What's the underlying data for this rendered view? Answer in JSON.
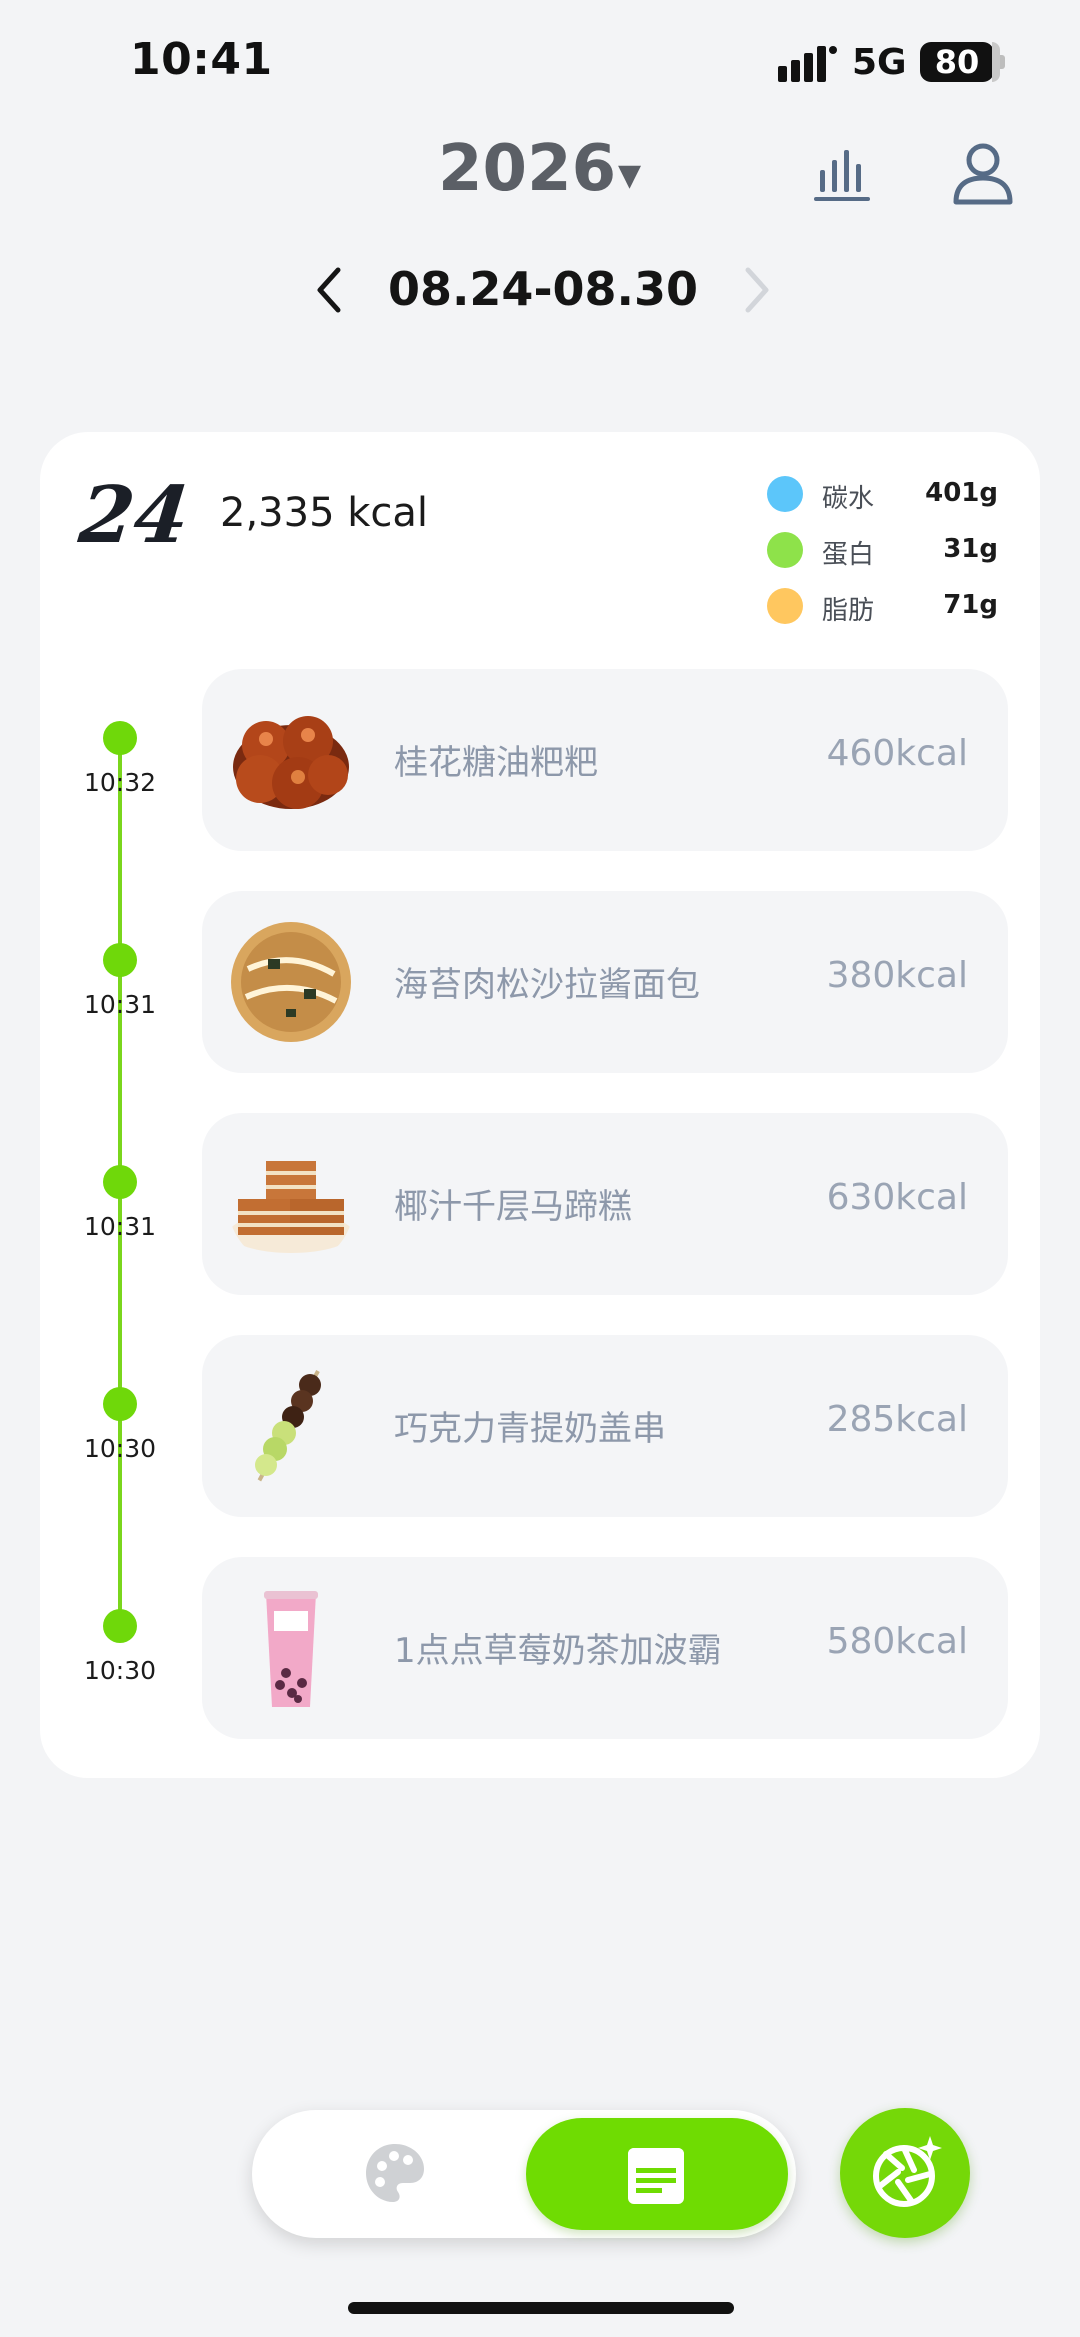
{
  "status_bar": {
    "time": "10:41",
    "network": "5G",
    "battery": "80"
  },
  "header": {
    "year": "2026",
    "year_caret": "▼",
    "date_range": "08.24-08.30"
  },
  "summary": {
    "day": "24",
    "total": "2,335 kcal",
    "macros": [
      {
        "label": "碳水",
        "value": "401g",
        "color": "#5cc6fa"
      },
      {
        "label": "蛋白",
        "value": "31g",
        "color": "#8ee24a"
      },
      {
        "label": "脂肪",
        "value": "71g",
        "color": "#ffc75f"
      }
    ]
  },
  "meals": [
    {
      "time": "10:32",
      "name": "桂花糖油粑粑",
      "kcal": "460kcal",
      "icon": "glazed-rice-cake-icon"
    },
    {
      "time": "10:31",
      "name": "海苔肉松沙拉酱面包",
      "kcal": "380kcal",
      "icon": "seaweed-pork-floss-bun-icon"
    },
    {
      "time": "10:31",
      "name": "椰汁千层马蹄糕",
      "kcal": "630kcal",
      "icon": "layered-water-chestnut-cake-icon"
    },
    {
      "time": "10:30",
      "name": "巧克力青提奶盖串",
      "kcal": "285kcal",
      "icon": "chocolate-grape-skewer-icon"
    },
    {
      "time": "10:30",
      "name": "1点点草莓奶茶加波霸",
      "kcal": "580kcal",
      "icon": "strawberry-milk-tea-icon"
    }
  ],
  "colors": {
    "accent": "#6fdc02",
    "card": "#ffffff",
    "background": "#f3f4f6"
  }
}
